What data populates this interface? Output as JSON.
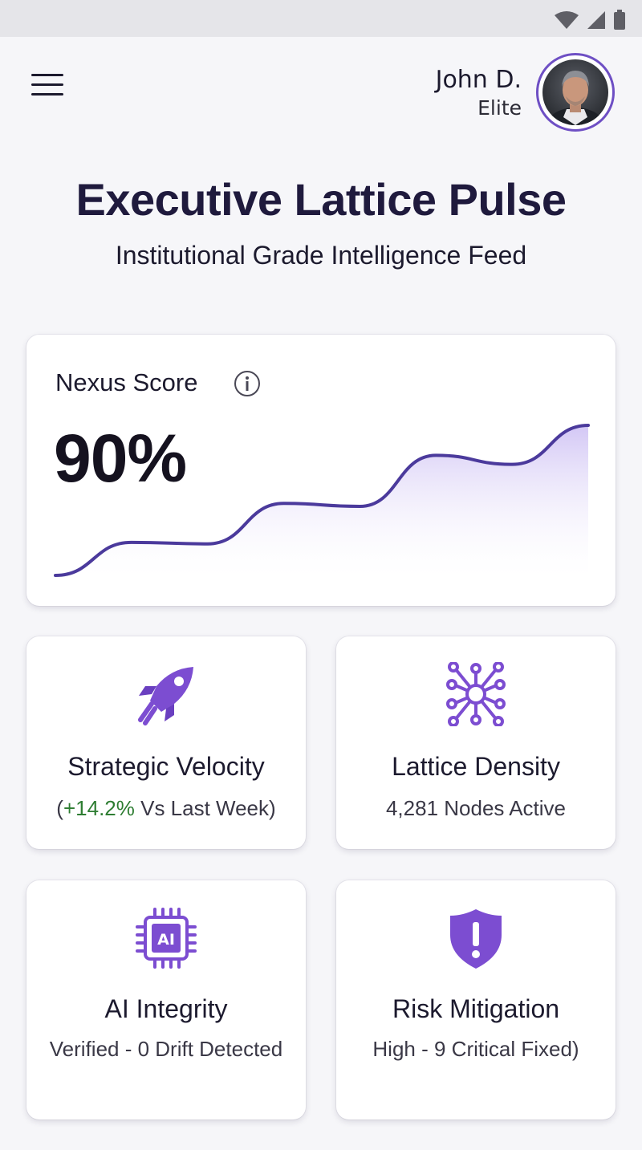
{
  "colors": {
    "accent": "#6e4fc4",
    "accent_light": "#e4dcfa",
    "positive": "#2e7d32",
    "title": "#1f1a3d"
  },
  "status_bar": {
    "icons": [
      "wifi-icon",
      "cell-signal-icon",
      "battery-icon"
    ]
  },
  "header": {
    "menu_icon": "hamburger-menu-icon",
    "user_name": "John D.",
    "user_tier": "Elite"
  },
  "page": {
    "title": "Executive Lattice Pulse",
    "subtitle": "Institutional Grade Intelligence Feed"
  },
  "score_card": {
    "label": "Nexus Score",
    "info_icon": "info-icon",
    "value": "90%"
  },
  "chart_data": {
    "type": "area",
    "values": [
      0,
      22,
      21,
      48,
      46,
      80,
      74,
      100
    ],
    "title": "",
    "xlabel": "",
    "ylabel": ""
  },
  "tiles": [
    {
      "icon": "rocket-icon",
      "title": "Strategic Velocity",
      "sub_prefix": "(",
      "sub_delta": "+14.2%",
      "sub_suffix": " Vs Last Week)"
    },
    {
      "icon": "network-nodes-icon",
      "title": "Lattice Density",
      "sub": "4,281 Nodes Active"
    },
    {
      "icon": "ai-chip-icon",
      "chip_text": "AI",
      "title": "AI Integrity",
      "sub": "Verified - 0 Drift Detected"
    },
    {
      "icon": "shield-alert-icon",
      "title": "Risk Mitigation",
      "sub": "High - 9 Critical Fixed)"
    }
  ]
}
